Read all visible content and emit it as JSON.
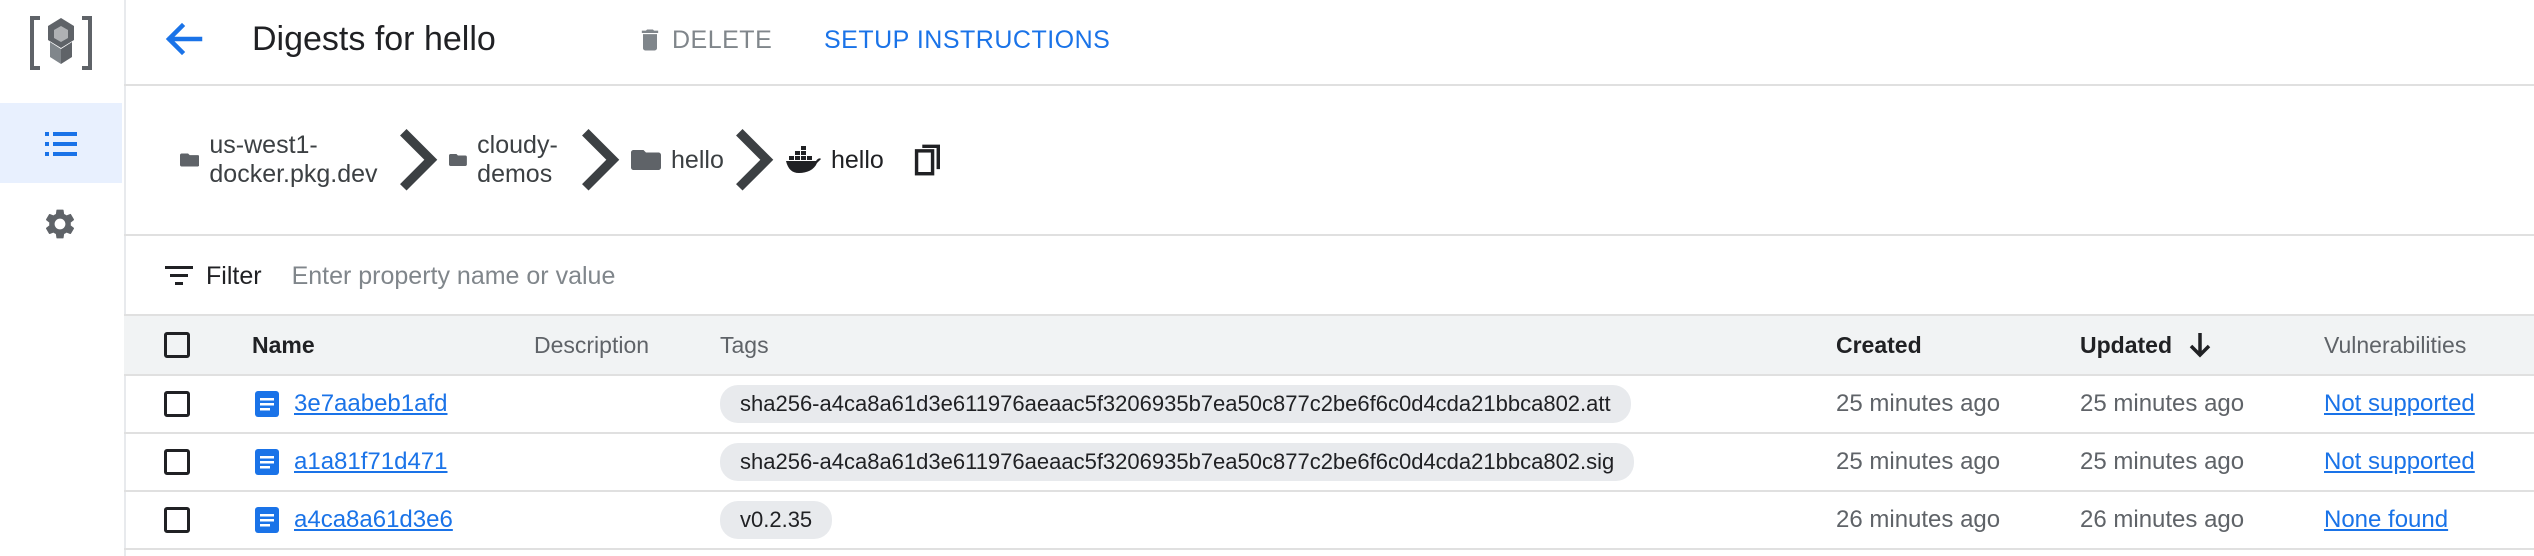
{
  "header": {
    "title": "Digests for hello",
    "delete_label": "DELETE",
    "setup_label": "SETUP INSTRUCTIONS"
  },
  "breadcrumb": [
    {
      "label": "us-west1-docker.pkg.dev",
      "icon": "folder-icon"
    },
    {
      "label": "cloudy-demos",
      "icon": "folder-icon"
    },
    {
      "label": "hello",
      "icon": "folder-icon"
    },
    {
      "label": "hello",
      "icon": "docker-icon"
    }
  ],
  "filter": {
    "label": "Filter",
    "placeholder": "Enter property name or value"
  },
  "table": {
    "columns": {
      "name": "Name",
      "description": "Description",
      "tags": "Tags",
      "created": "Created",
      "updated": "Updated",
      "vulnerabilities": "Vulnerabilities"
    },
    "sort": {
      "column": "Updated",
      "direction": "descending"
    },
    "rows": [
      {
        "name": "3e7aabeb1afd",
        "description": "",
        "tag": "sha256-a4ca8a61d3e611976aeaac5f3206935b7ea50c877c2be6f6c0d4cda21bbca802.att",
        "created": "25 minutes ago",
        "updated": "25 minutes ago",
        "vulnerabilities": "Not supported"
      },
      {
        "name": "a1a81f71d471",
        "description": "",
        "tag": "sha256-a4ca8a61d3e611976aeaac5f3206935b7ea50c877c2be6f6c0d4cda21bbca802.sig",
        "created": "25 minutes ago",
        "updated": "25 minutes ago",
        "vulnerabilities": "Not supported"
      },
      {
        "name": "a4ca8a61d3e6",
        "description": "",
        "tag": "v0.2.35",
        "created": "26 minutes ago",
        "updated": "26 minutes ago",
        "vulnerabilities": "None found"
      }
    ]
  },
  "colors": {
    "accent": "#1a73e8",
    "nav_active_bg": "#e8f0fe",
    "header_row_bg": "#f1f3f4",
    "chip_bg": "#e8eaed"
  }
}
